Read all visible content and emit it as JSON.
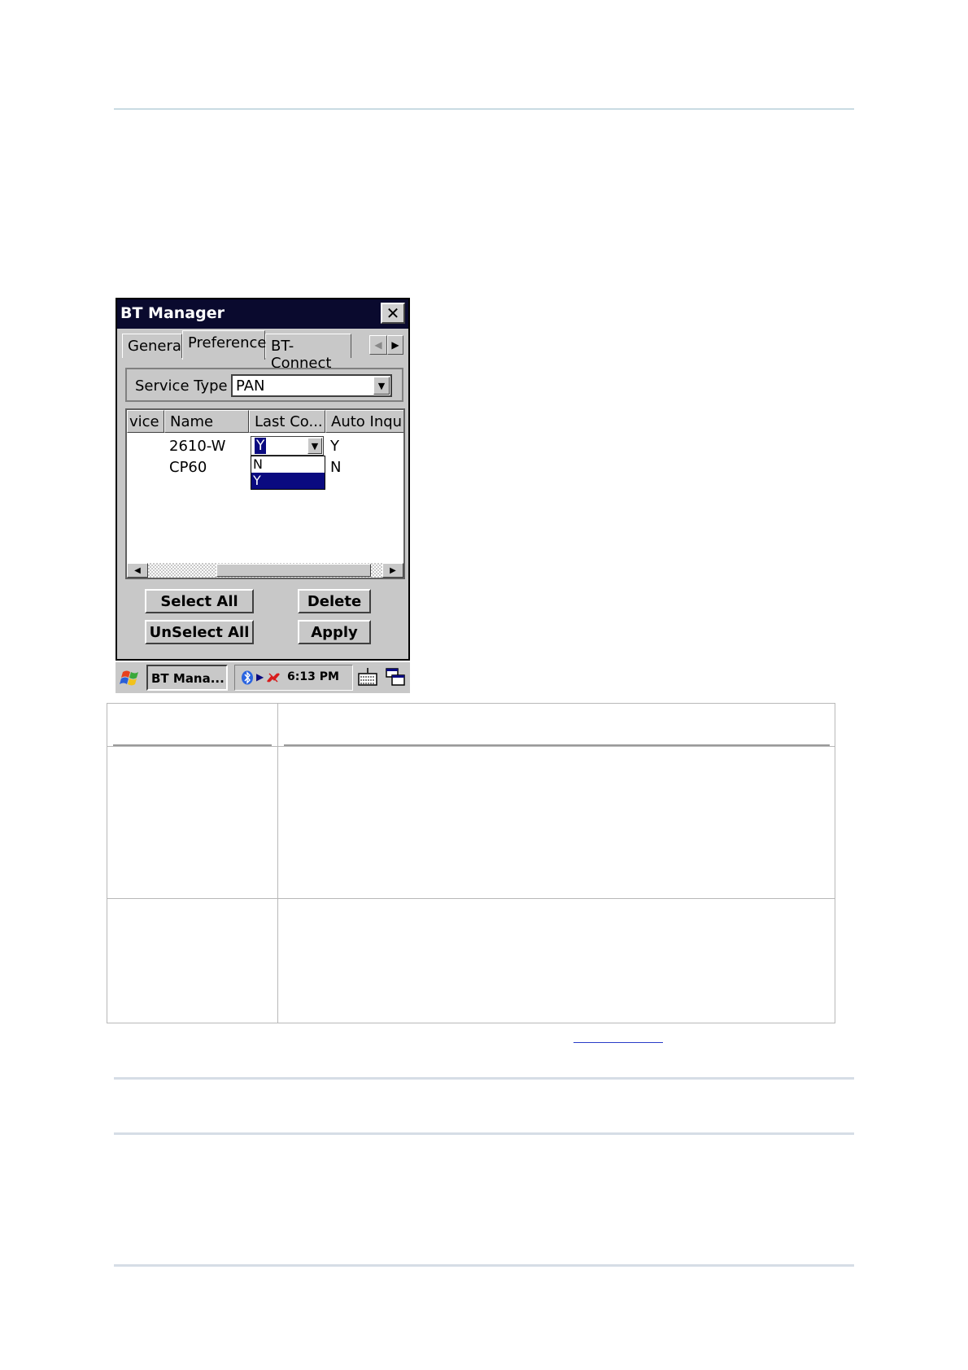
{
  "window": {
    "title": "BT Manager",
    "close_glyph": "✕",
    "tabs": [
      "General",
      "Preference",
      "BT-Connect"
    ],
    "active_tab": "Preference",
    "service_type_label": "Service Type",
    "service_type_value": "PAN",
    "columns": [
      "vice",
      "Name",
      "Last Co...",
      "Auto Inqu"
    ],
    "rows": [
      {
        "name": "2610-W",
        "last_connect": "Y",
        "auto_inquiry": "Y"
      },
      {
        "name": "CP60",
        "last_connect": "",
        "auto_inquiry": "N"
      }
    ],
    "dropdown_options": [
      "N",
      "Y"
    ],
    "dropdown_selected": "Y",
    "buttons": {
      "select_all": "Select All",
      "delete": "Delete",
      "unselect_all": "UnSelect All",
      "apply": "Apply"
    }
  },
  "taskbar": {
    "task_label": "BT Mana...",
    "clock": "6:13 PM",
    "icons": [
      "start-icon",
      "bluetooth-icon",
      "network-icon",
      "keyboard-icon",
      "desktop-icon"
    ]
  },
  "colors": {
    "title_bar": "#0a0a2e",
    "selection": "#0a0a80",
    "face": "#c8c8c8"
  }
}
